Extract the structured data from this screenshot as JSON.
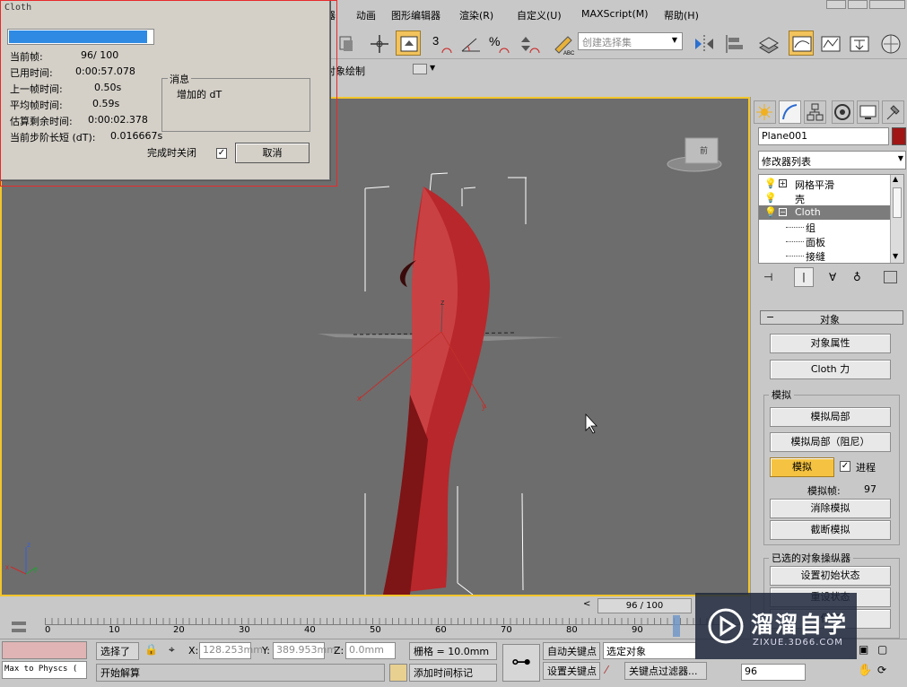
{
  "menubar": {
    "items": [
      "器",
      "动画",
      "图形编辑器",
      "渲染(R)",
      "自定义(U)",
      "MAXScript(M)",
      "帮助(H)"
    ]
  },
  "toolbar": {
    "selection_set_placeholder": "创建选择集",
    "object_paint_label": "对象绘制"
  },
  "cloth_dialog": {
    "title": "Cloth",
    "progress_fraction": 0.96,
    "rows": [
      {
        "label": "当前帧:",
        "value": "96/  100"
      },
      {
        "label": "已用时间:",
        "value": "0:00:57.078"
      },
      {
        "label": "上一帧时间:",
        "value": "0.50s"
      },
      {
        "label": "平均帧时间:",
        "value": "0.59s"
      },
      {
        "label": "估算剩余时间:",
        "value": "0:00:02.378"
      },
      {
        "label": "当前步阶长短 (dT):",
        "value": "0.016667s"
      }
    ],
    "message_group": "消息",
    "message_text": "增加的 dT",
    "close_on_complete_label": "完成时关闭",
    "close_on_complete_checked": true,
    "cancel_label": "取消"
  },
  "viewport": {
    "viewcube_label": "前"
  },
  "command_panel": {
    "object_name": "Plane001",
    "object_color": "#a11515",
    "modifier_list_label": "修改器列表",
    "stack": [
      {
        "label": "网格平滑",
        "level": 0,
        "selected": false
      },
      {
        "label": "壳",
        "level": 0,
        "selected": false
      },
      {
        "label": "Cloth",
        "level": 0,
        "selected": true
      },
      {
        "label": "组",
        "level": 1,
        "selected": false
      },
      {
        "label": "面板",
        "level": 1,
        "selected": false
      },
      {
        "label": "接缝",
        "level": 1,
        "selected": false
      }
    ],
    "rollout_title": "对象",
    "object_properties_label": "对象属性",
    "cloth_forces_label": "Cloth 力",
    "simulate_group": "模拟",
    "simulate_local_label": "模拟局部",
    "simulate_local_damped_label": "模拟局部（阻尼）",
    "simulate_label": "模拟",
    "progress_label": "进程",
    "progress_checked": true,
    "sim_frame_label": "模拟帧:",
    "sim_frame_value": "97",
    "erase_sim_label": "消除模拟",
    "truncate_sim_label": "截断模拟",
    "selected_manip_group": "已选的对象操纵器",
    "set_initial_state_label": "设置初始状态",
    "reset_state_label": "重设状态",
    "save_label": "保存"
  },
  "timeline": {
    "frame_indicator": "96 / 100",
    "current_frame": 96,
    "total_frames": 100,
    "ticks": [
      "0",
      "10",
      "20",
      "30",
      "40",
      "50",
      "60",
      "70",
      "80",
      "90"
    ]
  },
  "statusbar": {
    "script_text": "Max to Physcs (",
    "selection_status": "选择了",
    "prompt_text": "开始解算",
    "x_label": "X:",
    "x_value": "128.253mm",
    "y_label": "Y:",
    "y_value": "389.953mm",
    "z_label": "Z:",
    "z_value": "0.0mm",
    "grid_label": "栅格 = 10.0mm",
    "add_time_tag_label": "添加时间标记",
    "auto_key_label": "自动关键点",
    "set_key_label": "设置关键点",
    "selected_object_label": "选定对象",
    "key_filters_label": "关键点过滤器...",
    "frame_field": "96"
  },
  "watermark": {
    "name": "溜溜自学",
    "url": "ZIXUE.3D66.COM"
  }
}
